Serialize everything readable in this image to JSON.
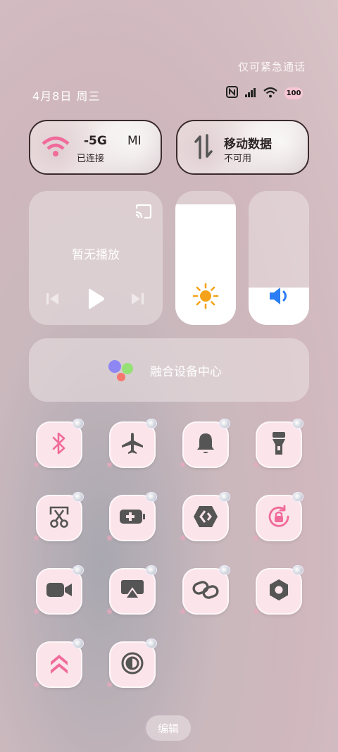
{
  "status_bar": {
    "emergency_text": "仅可紧急通话",
    "date_text": "4月8日 周三",
    "battery_level": "100",
    "icons": [
      "nfc-icon",
      "signal-icon",
      "wifi-icon",
      "battery-icon"
    ]
  },
  "wifi_card": {
    "title": "-5G",
    "title_suffix": "MI",
    "status": "已连接",
    "icon": "wifi-icon"
  },
  "mobile_card": {
    "title": "移动数据",
    "status": "不可用",
    "icon": "data-transfer-icon"
  },
  "media": {
    "title": "暂无播放",
    "icons": [
      "cast-icon",
      "previous-icon",
      "play-icon",
      "next-icon"
    ]
  },
  "brightness": {
    "level": 0.9,
    "icon": "sun-icon",
    "accent": "#f3a21a"
  },
  "volume": {
    "level": 0.28,
    "icon": "speaker-icon",
    "accent": "#2a7df3"
  },
  "fusion": {
    "title": "融合设备中心",
    "icon": "device-hub-icon"
  },
  "toggles": [
    {
      "icon": "bluetooth-icon"
    },
    {
      "icon": "airplane-icon"
    },
    {
      "icon": "bell-icon"
    },
    {
      "icon": "flashlight-icon"
    },
    {
      "icon": "screenshot-icon"
    },
    {
      "icon": "battery-saver-icon"
    },
    {
      "icon": "link-share-icon"
    },
    {
      "icon": "rotation-lock-icon"
    },
    {
      "icon": "video-icon"
    },
    {
      "icon": "screen-cast-icon"
    },
    {
      "icon": "chain-link-icon"
    },
    {
      "icon": "settings-nut-icon"
    },
    {
      "icon": "double-up-icon"
    },
    {
      "icon": "contrast-icon"
    }
  ],
  "colors": {
    "tile_bg": "#fbe4ea",
    "accent_pink": "#f06b9a",
    "icon_dark": "#555555"
  },
  "edit_label": "编辑"
}
